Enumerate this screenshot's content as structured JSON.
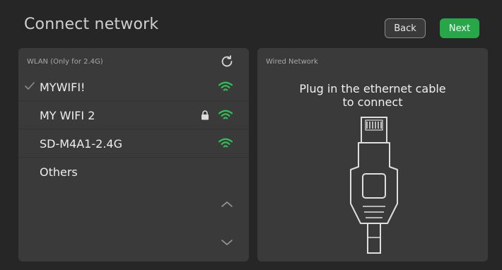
{
  "header": {
    "title": "Connect network",
    "back_label": "Back",
    "next_label": "Next"
  },
  "wlan": {
    "caption": "WLAN (Only for 2.4G)",
    "networks": [
      {
        "ssid": "MYWIFI!",
        "connected": true,
        "locked": false,
        "signal_icon": "wifi-signal-icon"
      },
      {
        "ssid": "MY WIFI 2",
        "connected": false,
        "locked": true,
        "signal_icon": "wifi-signal-icon"
      },
      {
        "ssid": "SD-M4A1-2.4G",
        "connected": false,
        "locked": false,
        "signal_icon": "wifi-signal-icon"
      },
      {
        "ssid": "Others",
        "connected": false,
        "locked": false
      }
    ]
  },
  "wired": {
    "caption": "Wired Network",
    "message_line1": "Plug in the ethernet cable",
    "message_line2": "to connect"
  },
  "colors": {
    "accent_green": "#27a64a",
    "signal_green": "#2fc255",
    "panel_bg": "#3a3a3a",
    "screen_bg": "#262626"
  }
}
